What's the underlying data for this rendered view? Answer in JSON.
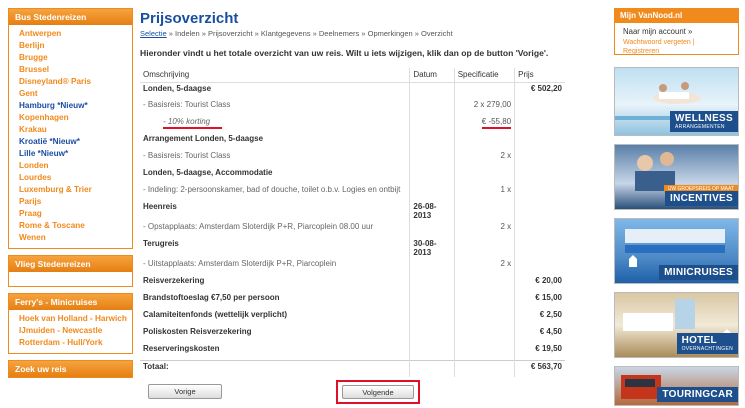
{
  "left": {
    "bus": {
      "title": "Bus Stedenreizen",
      "items": [
        {
          "label": "Antwerpen",
          "highlight": false
        },
        {
          "label": "Berlijn",
          "highlight": false
        },
        {
          "label": "Brugge",
          "highlight": false
        },
        {
          "label": "Brussel",
          "highlight": false
        },
        {
          "label": "Disneyland® Paris",
          "highlight": false
        },
        {
          "label": "Gent",
          "highlight": false
        },
        {
          "label": "Hamburg *Nieuw*",
          "highlight": true
        },
        {
          "label": "Kopenhagen",
          "highlight": false
        },
        {
          "label": "Krakau",
          "highlight": false
        },
        {
          "label": "Kroatië *Nieuw*",
          "highlight": true
        },
        {
          "label": "Lille *Nieuw*",
          "highlight": true
        },
        {
          "label": "Londen",
          "highlight": false
        },
        {
          "label": "Lourdes",
          "highlight": false
        },
        {
          "label": "Luxemburg & Trier",
          "highlight": false
        },
        {
          "label": "Parijs",
          "highlight": false
        },
        {
          "label": "Praag",
          "highlight": false
        },
        {
          "label": "Rome & Toscane",
          "highlight": false
        },
        {
          "label": "Wenen",
          "highlight": false
        }
      ]
    },
    "flight": {
      "title": "Vlieg Stedenreizen"
    },
    "ferry": {
      "title": "Ferry's - Minicruises",
      "items": [
        {
          "label": "Hoek van Holland - Harwich"
        },
        {
          "label": "IJmuiden - Newcastle"
        },
        {
          "label": "Rotterdam - Hull/York"
        }
      ]
    },
    "next_box": {
      "title": "Zoek uw reis"
    }
  },
  "main": {
    "title": "Prijsoverzicht",
    "breadcrumb": {
      "link": "Selectie",
      "rest": " » Indelen » Prijsoverzicht » Klantgegevens » Deelnemers » Opmerkingen » Overzicht"
    },
    "intro": "Hieronder vindt u het totale overzicht van uw reis. Wilt u iets wijzigen, klik dan op de button 'Vorige'.",
    "columns": {
      "desc": "Omschrijving",
      "date": "Datum",
      "spec": "Specificatie",
      "price": "Prijs"
    },
    "rows": [
      {
        "desc": "Londen, 5-daagse",
        "date": "",
        "spec": "",
        "price": "€ 502,20",
        "type": "main"
      },
      {
        "desc": "- Basisreis: Tourist Class",
        "date": "",
        "spec": "2 x 279,00",
        "price": "",
        "type": "sub"
      },
      {
        "desc": "- 10% korting",
        "date": "",
        "spec": "€ -55,80",
        "price": "",
        "type": "discount"
      },
      {
        "desc": "Arrangement Londen, 5-daagse",
        "date": "",
        "spec": "",
        "price": "",
        "type": "main"
      },
      {
        "desc": "- Basisreis: Tourist Class",
        "date": "",
        "spec": "2 x",
        "price": "",
        "type": "sub"
      },
      {
        "desc": "Londen, 5-daagse, Accommodatie",
        "date": "",
        "spec": "",
        "price": "",
        "type": "main"
      },
      {
        "desc": "- Indeling: 2-persoonskamer, bad of douche, toilet o.b.v. Logies en ontbijt",
        "date": "",
        "spec": "1 x",
        "price": "",
        "type": "sub"
      },
      {
        "desc": "Heenreis",
        "date": "26-08-2013",
        "spec": "",
        "price": "",
        "type": "main"
      },
      {
        "desc": "- Opstapplaats: Amsterdam Sloterdijk P+R, Piarcoplein 08.00 uur",
        "date": "",
        "spec": "2 x",
        "price": "",
        "type": "sub"
      },
      {
        "desc": "Terugreis",
        "date": "30-08-2013",
        "spec": "",
        "price": "",
        "type": "main"
      },
      {
        "desc": "- Uitstapplaats: Amsterdam Sloterdijk P+R, Piarcoplein",
        "date": "",
        "spec": "2 x",
        "price": "",
        "type": "sub"
      },
      {
        "desc": "Reisverzekering",
        "date": "",
        "spec": "",
        "price": "€ 20,00",
        "type": "main"
      },
      {
        "desc": "Brandstoftoeslag €7,50 per persoon",
        "date": "",
        "spec": "",
        "price": "€ 15,00",
        "type": "main"
      },
      {
        "desc": "Calamiteitenfonds (wettelijk verplicht)",
        "date": "",
        "spec": "",
        "price": "€ 2,50",
        "type": "main"
      },
      {
        "desc": "Poliskosten Reisverzekering",
        "date": "",
        "spec": "",
        "price": "€ 4,50",
        "type": "main"
      },
      {
        "desc": "Reserveringskosten",
        "date": "",
        "spec": "",
        "price": "€ 19,50",
        "type": "main"
      }
    ],
    "total": {
      "label": "Totaal:",
      "value": "€ 563,70"
    },
    "prev_button": "Vorige",
    "next_button": "Volgende"
  },
  "right": {
    "login": {
      "title": "Mijn VanNood.nl",
      "link": "Naar mijn account »",
      "forgot": "Wachtwoord vergeten | Registreren"
    },
    "banners": [
      {
        "label": "WELLNESS",
        "sub": "ARRANGEMENTEN"
      },
      {
        "tag": "UW GROEPSREIS OP MAAT",
        "label": "INCENTIVES"
      },
      {
        "label": "MINICRUISES"
      },
      {
        "label": "HOTEL",
        "sub": "OVERNACHTINGEN"
      },
      {
        "label": "TOURINGCAR"
      }
    ]
  },
  "colors": {
    "accent": "#f08a1c",
    "link": "#1a4fa0",
    "highlight": "#e0102a"
  }
}
